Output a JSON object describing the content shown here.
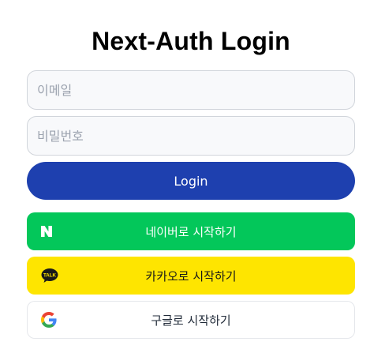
{
  "page": {
    "title": "Next-Auth Login"
  },
  "form": {
    "email_placeholder": "이메일",
    "email_value": "",
    "password_placeholder": "비밀번호",
    "password_value": "",
    "login_label": "Login"
  },
  "social": {
    "naver": {
      "label": "네이버로 시작하기",
      "icon": "naver-n-icon",
      "color": "#03c75a"
    },
    "kakao": {
      "label": "카카오로 시작하기",
      "icon": "kakao-talk-icon",
      "color": "#fee500",
      "badge_text": "TALK"
    },
    "google": {
      "label": "구글로 시작하기",
      "icon": "google-g-icon",
      "color": "#ffffff"
    }
  },
  "colors": {
    "login_button": "#1e40af"
  }
}
